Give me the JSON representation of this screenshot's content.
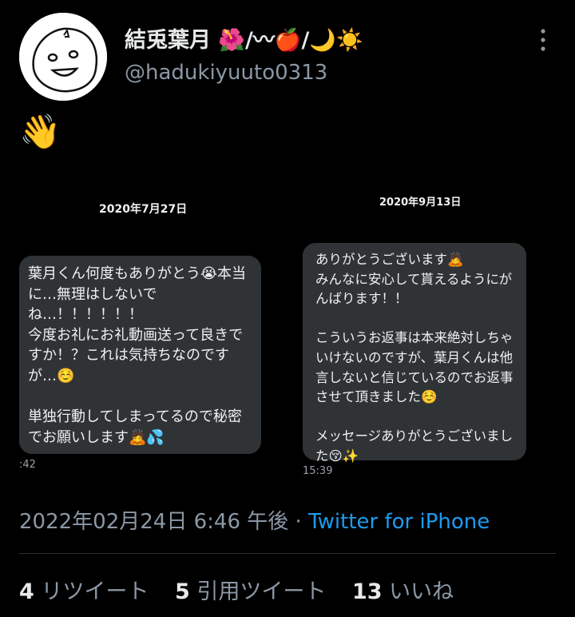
{
  "user": {
    "display_name": "結兎葉月 🌺/〰🍎/🌙☀️",
    "handle": "@hadukiyuuto0313"
  },
  "tweet": {
    "text": "👋"
  },
  "screenshots": [
    {
      "date": "2020年7月27日",
      "message": "葉月くん何度もありがとう😭本当に…無理はしないでね…！！！！！！\n今度お礼にお礼動画送って良きですか！？これは気持ちなのですが…☺️\n\n単独行動してしまってるので秘密でお願いします🙇💦",
      "time": ":42"
    },
    {
      "date": "2020年9月13日",
      "message": "ありがとうございます🙇\nみんなに安心して貰えるようにがんばります！！\n\nこういうお返事は本来絶対しちゃいけないのですが、葉月くんは他言しないと信じているのでお返事させて頂きました☺️\n\nメッセージありがとうございました😚✨",
      "time": "15:39"
    }
  ],
  "meta": {
    "datetime": "2022年02月24日 6:46 午後",
    "separator": "·",
    "source": "Twitter for iPhone"
  },
  "stats": {
    "retweets": {
      "count": "4",
      "label": "リツイート"
    },
    "quotes": {
      "count": "5",
      "label": "引用ツイート"
    },
    "likes": {
      "count": "13",
      "label": "いいね"
    }
  }
}
